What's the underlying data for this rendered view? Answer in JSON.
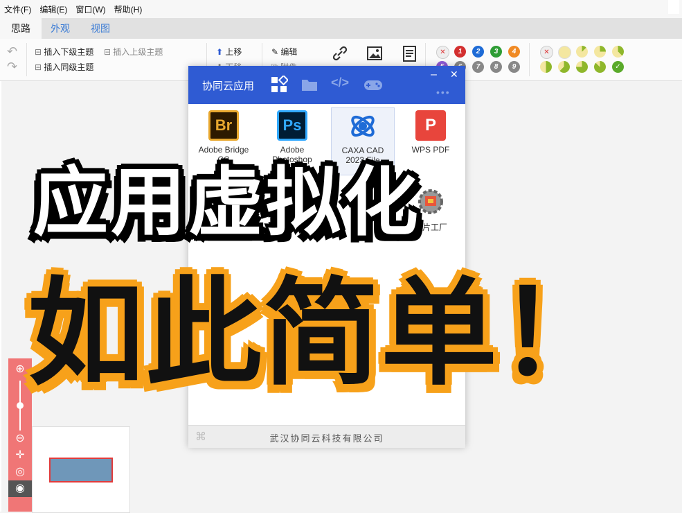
{
  "menu": [
    "文件(F)",
    "编辑(E)",
    "窗口(W)",
    "帮助(H)"
  ],
  "tabs": [
    "思路",
    "外观",
    "视图"
  ],
  "ribbon": {
    "insert_child": "插入下级主题",
    "insert_parent": "插入上级主题",
    "insert_sibling": "插入同级主题",
    "move_up": "上移",
    "move_down": "下移",
    "edit": "编辑",
    "attach": "附件",
    "link": "链接",
    "image": "图片",
    "note": "备注",
    "priority_numbers": [
      "1",
      "2",
      "3",
      "4",
      "5",
      "6",
      "7",
      "8",
      "9"
    ]
  },
  "popup": {
    "title": "协同云应用",
    "apps": [
      {
        "line1": "Adobe Bridge",
        "line2": "CC",
        "icon": "bridge-icon",
        "color": "#2d1a00"
      },
      {
        "line1": "Adobe",
        "line2": "Photoshop",
        "icon": "photoshop-icon",
        "color": "#001d35"
      },
      {
        "line1": "CAXA CAD",
        "line2": "2023 File",
        "icon": "caxa-icon",
        "color": "#1e6bd6"
      },
      {
        "line1": "WPS PDF",
        "line2": "",
        "icon": "wps-pdf-icon",
        "color": "#e8453c"
      },
      {
        "line1": "图片工厂",
        "line2": "",
        "icon": "picture-factory-icon",
        "color": "#888888"
      }
    ],
    "footer": "武汉协同云科技有限公司"
  },
  "overlay": {
    "line1": "应用虚拟化",
    "line2": "如此简单！"
  },
  "colors": {
    "accent": "#2f5bd3",
    "zoom_panel": "#f07676",
    "overlay_outline": "#f7a11a"
  }
}
